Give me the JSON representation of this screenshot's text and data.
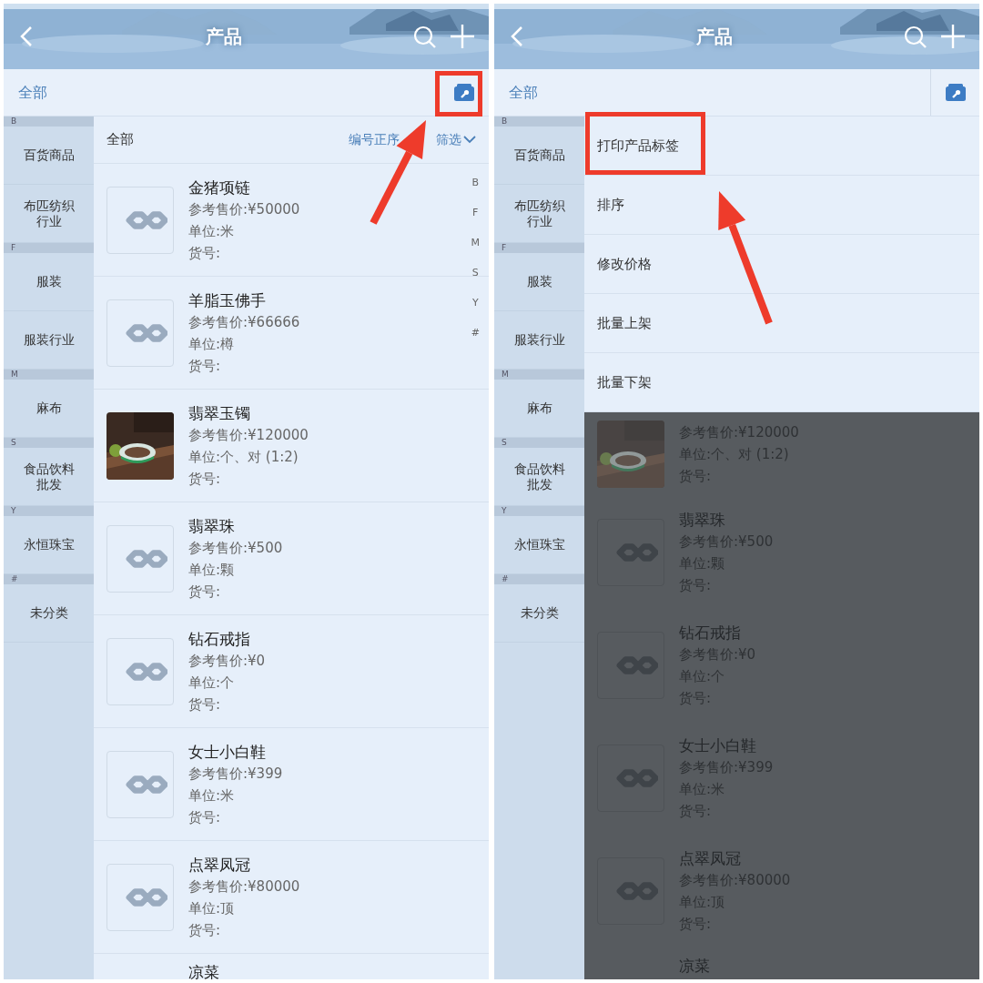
{
  "screens": [
    {
      "header": {
        "title": "产品"
      },
      "filter": {
        "label": "全部"
      },
      "sidebar": [
        {
          "letter": "B",
          "entries": [
            "百货商品",
            "布匹纺织行业"
          ]
        },
        {
          "letter": "F",
          "entries": [
            "服装",
            "服装行业"
          ]
        },
        {
          "letter": "M",
          "entries": [
            "麻布"
          ]
        },
        {
          "letter": "S",
          "entries": [
            "食品饮料批发"
          ]
        },
        {
          "letter": "Y",
          "entries": [
            "永恒珠宝"
          ]
        },
        {
          "letter": "#",
          "entries": [
            "未分类"
          ]
        }
      ],
      "list_header": {
        "label": "全部",
        "sort": "编号正序",
        "filter": "筛选"
      },
      "index_letters": [
        "B",
        "F",
        "M",
        "S",
        "Y",
        "#"
      ],
      "products": [
        {
          "kind": "placeholder",
          "name": "金猪项链",
          "price": "参考售价:¥50000",
          "unit": "单位:米",
          "code": "货号:"
        },
        {
          "kind": "placeholder",
          "name": "羊脂玉佛手",
          "price": "参考售价:¥66666",
          "unit": "单位:樽",
          "code": "货号:"
        },
        {
          "name": "翡翠玉镯",
          "price": "参考售价:¥120000",
          "unit": "单位:个、对 (1:2)",
          "code": "货号:"
        },
        {
          "kind": "placeholder",
          "name": "翡翠珠",
          "price": "参考售价:¥500",
          "unit": "单位:颗",
          "code": "货号:"
        },
        {
          "kind": "placeholder",
          "name": "钻石戒指",
          "price": "参考售价:¥0",
          "unit": "单位:个",
          "code": "货号:"
        },
        {
          "kind": "placeholder",
          "name": "女士小白鞋",
          "price": "参考售价:¥399",
          "unit": "单位:米",
          "code": "货号:"
        },
        {
          "kind": "placeholder",
          "name": "点翠凤冠",
          "price": "参考售价:¥80000",
          "unit": "单位:顶",
          "code": "货号:"
        },
        {
          "kind": "stub",
          "name": "凉菜"
        }
      ],
      "annotations": [
        {
          "kind": "frame"
        },
        {
          "kind": "arrow"
        }
      ]
    },
    {
      "header": {
        "title": "产品"
      },
      "filter": {
        "label": "全部"
      },
      "sidebar": [
        {
          "letter": "B",
          "entries": [
            "百货商品",
            "布匹纺织行业"
          ]
        },
        {
          "letter": "F",
          "entries": [
            "服装",
            "服装行业"
          ]
        },
        {
          "letter": "M",
          "entries": [
            "麻布"
          ]
        },
        {
          "letter": "S",
          "entries": [
            "食品饮料批发"
          ]
        },
        {
          "letter": "Y",
          "entries": [
            "永恒珠宝"
          ]
        },
        {
          "letter": "#",
          "entries": [
            "未分类"
          ]
        }
      ],
      "menu": [
        "打印产品标签",
        "排序",
        "修改价格",
        "批量上架",
        "批量下架"
      ],
      "products": [
        {
          "price": "参考售价:¥120000",
          "unit": "单位:个、对 (1:2)",
          "code": "货号:"
        },
        {
          "kind": "placeholder",
          "name": "翡翠珠",
          "price": "参考售价:¥500",
          "unit": "单位:颗",
          "code": "货号:"
        },
        {
          "kind": "placeholder",
          "name": "钻石戒指",
          "price": "参考售价:¥0",
          "unit": "单位:个",
          "code": "货号:"
        },
        {
          "kind": "placeholder",
          "name": "女士小白鞋",
          "price": "参考售价:¥399",
          "unit": "单位:米",
          "code": "货号:"
        },
        {
          "kind": "placeholder",
          "name": "点翠凤冠",
          "price": "参考售价:¥80000",
          "unit": "单位:顶",
          "code": "货号:"
        },
        {
          "kind": "stub",
          "name": "凉菜"
        }
      ],
      "annotations": [
        {
          "kind": "frame"
        },
        {
          "kind": "arrow"
        }
      ]
    }
  ]
}
